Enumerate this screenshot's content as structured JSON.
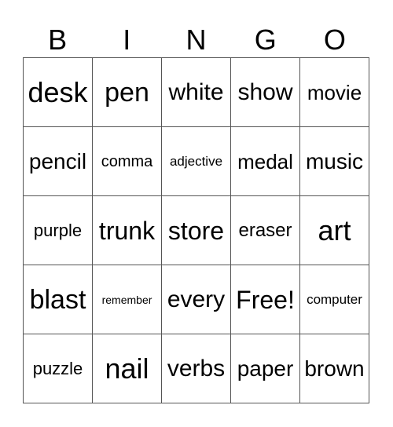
{
  "card": {
    "header": [
      "B",
      "I",
      "N",
      "G",
      "O"
    ],
    "rows": [
      [
        "desk",
        "pen",
        "white",
        "show",
        "movie"
      ],
      [
        "pencil",
        "comma",
        "adjective",
        "medal",
        "music"
      ],
      [
        "purple",
        "trunk",
        "store",
        "eraser",
        "art"
      ],
      [
        "blast",
        "remember",
        "every",
        "Free!",
        "computer"
      ],
      [
        "puzzle",
        "nail",
        "verbs",
        "paper",
        "brown"
      ]
    ]
  }
}
